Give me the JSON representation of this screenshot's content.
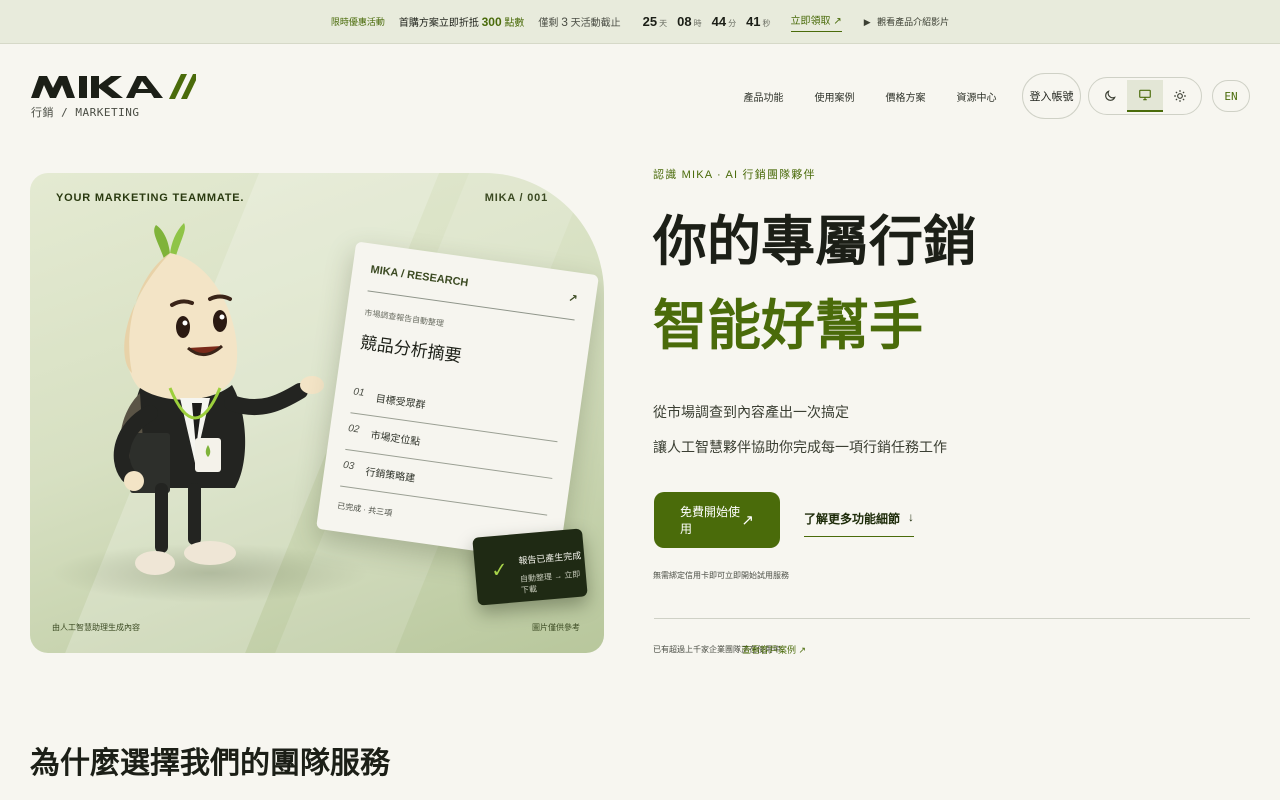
{
  "topbar": {
    "tag": "限時優惠活動",
    "promo_text": "首購方案立即折抵",
    "promo_amount": "300",
    "promo_unit": "點數",
    "ends_prefix": "僅剩",
    "ends_num": "3",
    "ends_suffix": "天活動截止",
    "countdown": [
      {
        "value": "25",
        "unit": "天"
      },
      {
        "value": "08",
        "unit": "時"
      },
      {
        "value": "44",
        "unit": "分"
      },
      {
        "value": "41",
        "unit": "秒"
      }
    ],
    "cta": "立即領取 ↗",
    "video_icon": "play-icon",
    "video_label": "觀看產品介紹影片"
  },
  "header": {
    "logo_text": "MIKA",
    "logo_sub": "行銷 / MARKETING",
    "nav": [
      "產品功能",
      "使用案例",
      "價格方案",
      "資源中心"
    ],
    "login": "登入帳號",
    "theme_options": [
      {
        "name": "dark",
        "icon": "moon-icon"
      },
      {
        "name": "system",
        "icon": "monitor-icon",
        "active": true
      },
      {
        "name": "light",
        "icon": "sun-icon"
      }
    ],
    "lang": "EN"
  },
  "hero_card": {
    "kicker_left": "YOUR MARKETING TEAMMATE.",
    "kicker_right": "MIKA / 001",
    "paper": {
      "header": "MIKA / RESEARCH",
      "kicker": "市場調查報告自動整理",
      "title": "競品分析摘要",
      "rows": [
        {
          "num": "01",
          "label": "目標受眾群"
        },
        {
          "num": "02",
          "label": "市場定位點"
        },
        {
          "num": "03",
          "label": "行銷策略建"
        }
      ],
      "footer": "已完成 · 共三項"
    },
    "badge": {
      "title": "報告已產生完成",
      "sub": "自動整理 → 立即下載"
    },
    "footer_left": "由人工智慧助理生成內容",
    "footer_right": "圖片僅供參考"
  },
  "hero_text": {
    "eyebrow": "認識 MIKA · AI 行銷團隊夥伴",
    "headline_1": "你的專屬行銷",
    "headline_2": "智能好幫手",
    "lead_1": "從市場調查到內容產出一次搞定",
    "lead_2": "讓人工智慧夥伴協助你完成每一項行銷任務工作",
    "primary_cta": "免費開始使用",
    "primary_cta_icon": "arrow-up-right-icon",
    "secondary_cta": "了解更多功能細節",
    "secondary_cta_icon": "arrow-down-icon",
    "note": "無需綁定信用卡即可立即開始試用服務",
    "sub_note": "已有超過上千家企業團隊正在使用中",
    "sub_link": "查看客戶案例 ↗"
  },
  "section": {
    "title": "為什麼選擇我們的團隊服務"
  }
}
